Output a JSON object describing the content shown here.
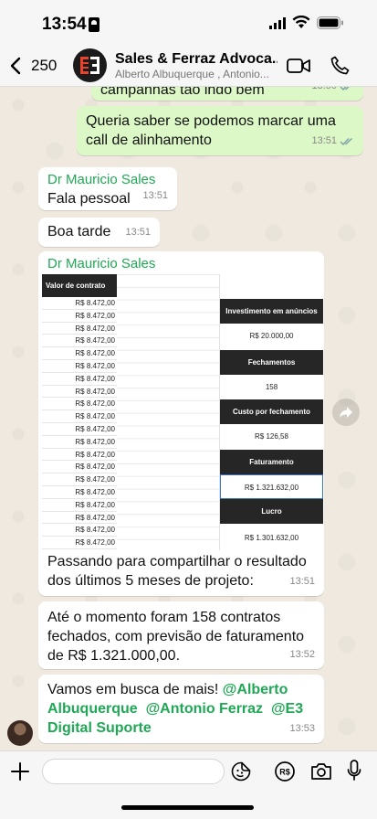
{
  "status_bar": {
    "time": "13:54"
  },
  "header": {
    "back_count": "250",
    "contact_name": "Sales & Ferraz Advoca...",
    "contact_subtitle": "Alberto Albuquerque , Antonio..."
  },
  "messages": [
    {
      "id": "m0",
      "direction": "out",
      "text": "campanhas tão indo bem",
      "time": "13:50"
    },
    {
      "id": "m1",
      "direction": "out",
      "text": "Queria saber se podemos marcar uma call de alinhamento",
      "time": "13:51"
    },
    {
      "id": "m2",
      "direction": "in",
      "sender": "Dr Mauricio Sales",
      "text": "Fala pessoal",
      "time": "13:51"
    },
    {
      "id": "m3",
      "direction": "in",
      "text": "Boa tarde",
      "time": "13:51"
    },
    {
      "id": "m4",
      "direction": "in",
      "sender": "Dr Mauricio Sales",
      "text": "Passando para compartilhar o resultado dos últimos 5 meses de projeto:",
      "time": "13:51"
    },
    {
      "id": "m5",
      "direction": "in",
      "text": "Até o momento foram 158 contratos fechados, com previsão de faturamento de R$ 1.321.000,00.",
      "time": "13:52"
    },
    {
      "id": "m6",
      "direction": "in",
      "text_prefix": "Vamos em busca de mais! ",
      "mention_1": "@Alberto Albuquerque",
      "mention_2": "@Antonio Ferraz",
      "mention_3": "@E3 Digital Suporte",
      "time": "13:53"
    }
  ],
  "table": {
    "left_header": "Valor de contrato",
    "left_rows": [
      "R$ 8.472,00",
      "R$ 8.472,00",
      "R$ 8.472,00",
      "R$ 8.472,00",
      "R$ 8.472,00",
      "R$ 8.472,00",
      "R$ 8.472,00",
      "R$ 8.472,00",
      "R$ 8.472,00",
      "R$ 8.472,00",
      "R$ 8.472,00",
      "R$ 8.472,00",
      "R$ 8.472,00",
      "R$ 8.472,00",
      "R$ 8.472,00",
      "R$ 8.472,00",
      "R$ 8.472,00",
      "R$ 8.472,00",
      "R$ 8.472,00",
      "R$ 8.472,00"
    ],
    "investimento_label": "Investimento em anúncios",
    "investimento_value": "R$ 20.000,00",
    "fechamentos_label": "Fechamentos",
    "fechamentos_value": "158",
    "custo_label": "Custo por fechamento",
    "custo_value": "R$ 126,58",
    "faturamento_label": "Faturamento",
    "faturamento_value": "R$ 1.321.632,00",
    "lucro_label": "Lucro",
    "lucro_value": "R$ 1.301.632,00"
  },
  "input": {
    "placeholder": ""
  },
  "colors": {
    "outgoing": "#dcf8c6",
    "incoming": "#ffffff",
    "sender": "#1fa855",
    "background": "#efe9df"
  }
}
